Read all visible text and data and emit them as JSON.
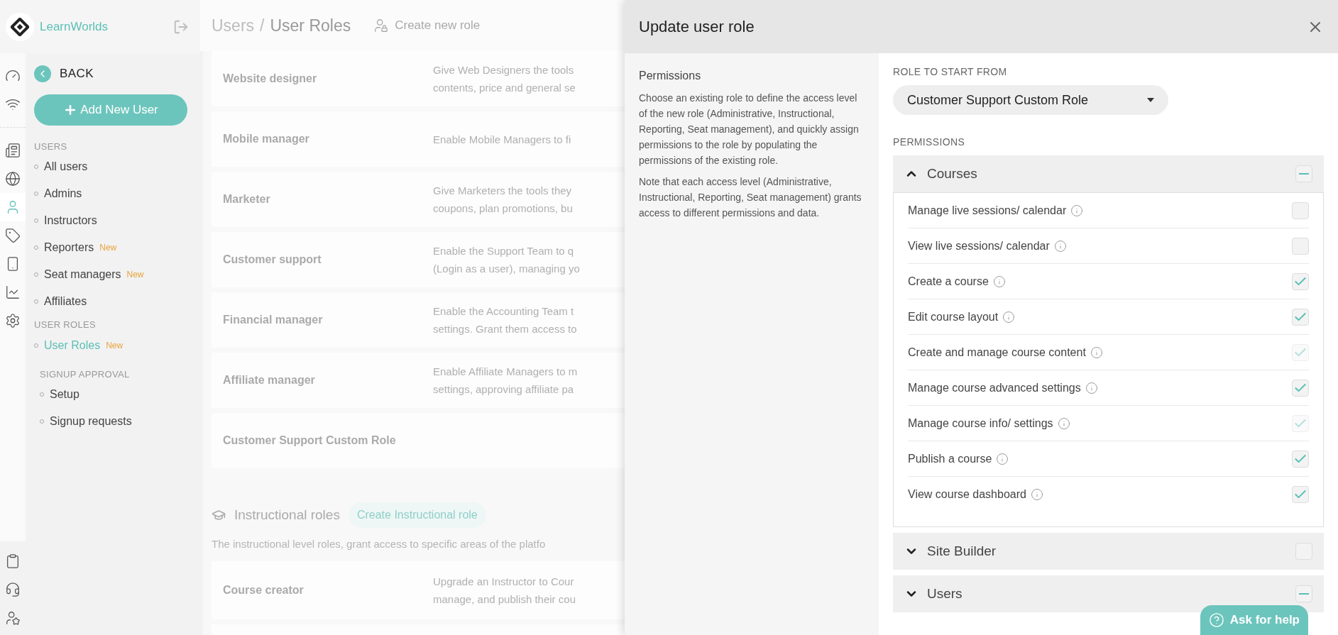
{
  "brand": {
    "name": "LearnWorlds"
  },
  "rail": {
    "top": [
      {
        "selected": false
      },
      {
        "selected": false
      }
    ],
    "middle": [
      {
        "selected": false
      },
      {
        "selected": false
      },
      {
        "selected": true
      },
      {
        "selected": false
      },
      {
        "selected": false
      },
      {
        "selected": false
      },
      {
        "selected": false
      }
    ],
    "bottom": [
      {
        "selected": false
      },
      {
        "selected": false
      },
      {
        "selected": false
      }
    ]
  },
  "sidebar": {
    "back": "BACK",
    "add_button": "Add New User",
    "sections": [
      {
        "kind": "main",
        "title": "USERS",
        "items": [
          {
            "label": "All users",
            "selected": false
          },
          {
            "label": "Admins",
            "selected": false
          },
          {
            "label": "Instructors",
            "selected": false
          },
          {
            "label": "Reporters",
            "badge": "New",
            "selected": false
          },
          {
            "label": "Seat managers",
            "badge": "New",
            "selected": false
          },
          {
            "label": "Affiliates",
            "selected": false
          }
        ]
      },
      {
        "kind": "main",
        "title": "USER ROLES",
        "items": [
          {
            "label": "User Roles",
            "badge": "New",
            "selected": true
          }
        ]
      },
      {
        "kind": "sub",
        "title": "SIGNUP APPROVAL",
        "items": [
          {
            "label": "Setup",
            "selected": false
          },
          {
            "label": "Signup requests",
            "selected": false
          }
        ]
      }
    ]
  },
  "breadcrumb": {
    "parent": "Users",
    "separator": "/",
    "current": "User Roles"
  },
  "create_role": "Create new role",
  "roles": [
    {
      "name": "Website designer",
      "description": [
        "Give Web Designers the tools",
        "contents, price and general se"
      ]
    },
    {
      "name": "Mobile manager",
      "description": [
        "Enable Mobile Managers to fi"
      ]
    },
    {
      "name": "Marketer",
      "description": [
        "Give Marketers the tools they",
        "coupons, plan promotions, bu"
      ]
    },
    {
      "name": "Customer support",
      "description": [
        "Enable the Support Team to q",
        "(Login as a user), managing yo"
      ]
    },
    {
      "name": "Financial manager",
      "description": [
        "Enable the Accounting Team t",
        "settings. Grant them access to"
      ]
    },
    {
      "name": "Affiliate manager",
      "description": [
        "Enable Affiliate Managers to m",
        "settings, approving affiliate pa"
      ]
    },
    {
      "name": "Customer Support Custom Role"
    }
  ],
  "instructional": {
    "title": "Instructional roles",
    "button": "Create Instructional role",
    "description": "The instructional level roles, grant access to specific areas of the platfo"
  },
  "instructional_roles": [
    {
      "name": "Course creator",
      "description": [
        "Upgrade an Instructor to Cour",
        "manage, and publish their cou"
      ]
    }
  ],
  "panel": {
    "title": "Update user role",
    "side_title": "Permissions",
    "side_paragraphs": [
      "Choose an existing role to define the access level of the new role (Administrative, Instructional, Reporting, Seat management), and quickly assign permissions to the role by populating the permissions of the existing role.",
      "Note that each access level (Administrative, Instructional, Reporting, Seat management) grants access to different permissions and data."
    ],
    "role_label": "ROLE TO START FROM",
    "role_value": "Customer Support Custom Role",
    "permissions_label": "PERMISSIONS",
    "groups": [
      {
        "label": "Courses",
        "expanded": true,
        "indeterminate": true,
        "items": [
          {
            "label": "Manage live sessions/ calendar",
            "checked": false,
            "disabled": false
          },
          {
            "label": "View live sessions/ calendar",
            "checked": false,
            "disabled": false
          },
          {
            "label": "Create a course",
            "checked": true,
            "disabled": false
          },
          {
            "label": "Edit course layout",
            "checked": true,
            "disabled": false
          },
          {
            "label": "Create and manage course content",
            "checked": true,
            "disabled": true
          },
          {
            "label": "Manage course advanced settings",
            "checked": true,
            "disabled": false
          },
          {
            "label": "Manage course info/ settings",
            "checked": true,
            "disabled": true
          },
          {
            "label": "Publish a course",
            "checked": true,
            "disabled": false
          },
          {
            "label": "View course dashboard",
            "checked": true,
            "disabled": false
          }
        ]
      },
      {
        "label": "Site Builder",
        "expanded": false,
        "indeterminate": false
      },
      {
        "label": "Users",
        "expanded": false,
        "indeterminate": true
      }
    ]
  },
  "help": "Ask for help"
}
